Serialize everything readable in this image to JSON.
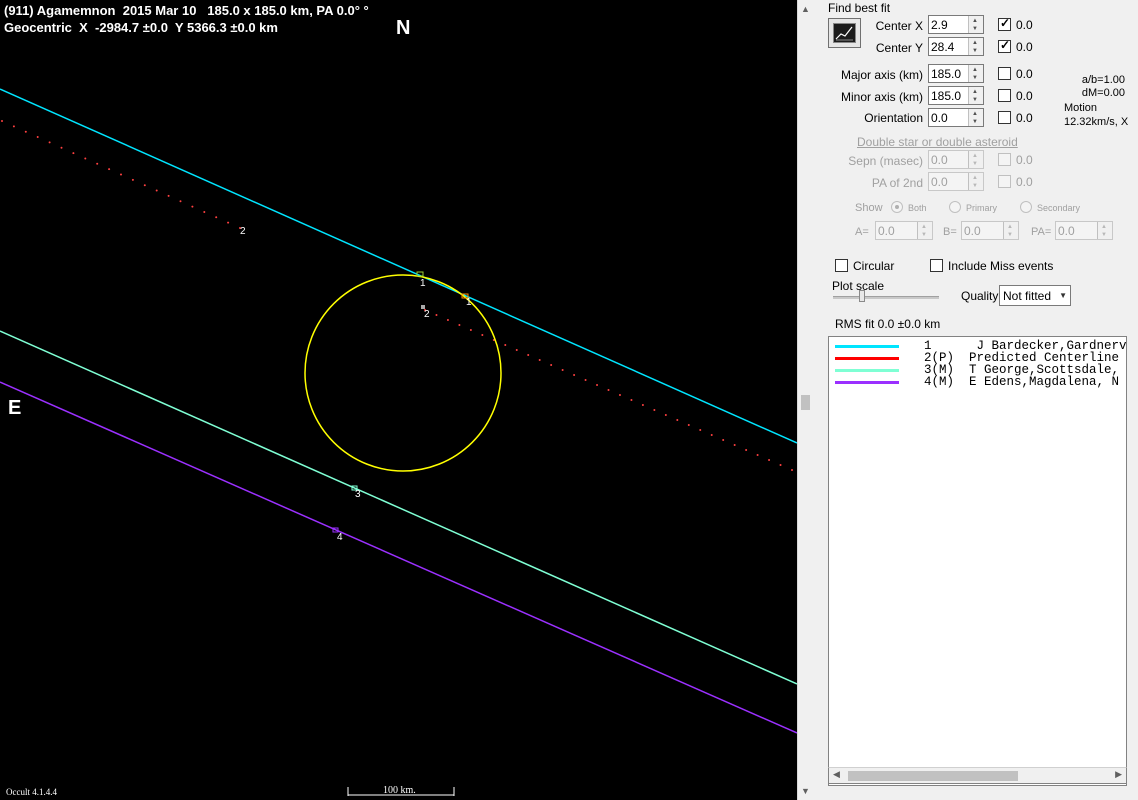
{
  "plot": {
    "header_line1": "(911) Agamemnon  2015 Mar 10   185.0 x 185.0 km, PA 0.0° °",
    "header_line2": "Geocentric  X  -2984.7 ±0.0  Y 5366.3 ±0.0 km",
    "north_label": "N",
    "east_label": "E",
    "version": "Occult 4.1.4.4",
    "scale_label": "100 km.",
    "chord_labels": [
      "1",
      "1",
      "2",
      "2",
      "3",
      "4"
    ],
    "colors": {
      "background": "#000000",
      "ellipse": "#ffff00",
      "chord1": "#00e5ff",
      "chord2": "#ff4040",
      "chord3": "#7fffd4",
      "chord4": "#9b30ff"
    }
  },
  "panel": {
    "find_best_fit": "Find best fit",
    "center_x": {
      "label": "Center X",
      "value": "2.9",
      "checked": true,
      "uncertainty": "0.0"
    },
    "center_y": {
      "label": "Center Y",
      "value": "28.4",
      "checked": true,
      "uncertainty": "0.0"
    },
    "major_axis": {
      "label": "Major axis (km)",
      "value": "185.0",
      "checked": false,
      "uncertainty": "0.0"
    },
    "minor_axis": {
      "label": "Minor axis (km)",
      "value": "185.0",
      "checked": false,
      "uncertainty": "0.0"
    },
    "orientation": {
      "label": "Orientation",
      "value": "0.0",
      "checked": false,
      "uncertainty": "0.0"
    },
    "ab_ratio": "a/b=1.00",
    "dm": "dM=0.00",
    "motion_label": "Motion",
    "motion_value": "12.32km/s, X",
    "double_star_link": "Double star  or  double asteroid",
    "sepn": {
      "label": "Sepn (masec)",
      "value": "0.0",
      "uncertainty": "0.0"
    },
    "pa2nd": {
      "label": "PA of 2nd",
      "value": "0.0",
      "uncertainty": "0.0"
    },
    "show_label": "Show",
    "show_options": [
      "Both",
      "Primary",
      "Secondary"
    ],
    "a_field": {
      "label": "A=",
      "value": "0.0"
    },
    "b_field": {
      "label": "B=",
      "value": "0.0"
    },
    "pa_field": {
      "label": "PA=",
      "value": "0.0"
    },
    "circular_label": "Circular",
    "include_miss_label": "Include Miss events",
    "plot_scale_label": "Plot scale",
    "quality_label": "Quality",
    "quality_value": "Not fitted",
    "rms_fit": "RMS fit 0.0 ±0.0 km",
    "legend": [
      {
        "text": "1      J Bardecker,Gardnerv",
        "color": "#00e5ff"
      },
      {
        "text": "2(P)  Predicted Centerline",
        "color": "#ff0000"
      },
      {
        "text": "3(M)  T George,Scottsdale,",
        "color": "#7fffd4"
      },
      {
        "text": "4(M)  E Edens,Magdalena, N",
        "color": "#9b30ff"
      }
    ]
  }
}
